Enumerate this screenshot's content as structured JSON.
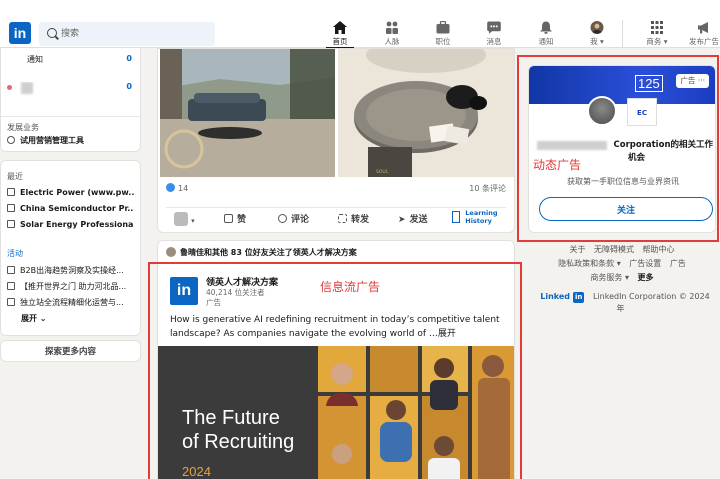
{
  "nav": {
    "search_placeholder": "搜索",
    "items": [
      {
        "label": "首页",
        "icon": "home-icon"
      },
      {
        "label": "人脉",
        "icon": "network-icon"
      },
      {
        "label": "职位",
        "icon": "briefcase-icon"
      },
      {
        "label": "消息",
        "icon": "message-icon"
      },
      {
        "label": "通知",
        "icon": "bell-icon"
      },
      {
        "label": "我 ▾",
        "icon": "avatar"
      },
      {
        "label": "商务 ▾",
        "icon": "grid-icon"
      },
      {
        "label": "发布广告",
        "icon": "megaphone-icon"
      }
    ]
  },
  "left": {
    "notifications": {
      "label": "通知",
      "count": "0"
    },
    "profile_count": "0",
    "business_title": "发展业务",
    "business_item": "试用营销管理工具",
    "recent_title": "最近",
    "recent": [
      "Electric Power (www.pw...",
      "China Semiconductor Pr...",
      "Solar Energy Professiona..."
    ],
    "events_title": "活动",
    "events": [
      "B2B出海趋势洞察及实操经...",
      "【推开世界之门 助力河北品...",
      "独立站全流程精细化运营与..."
    ],
    "expand": "展开 ⌄",
    "explore": "探索更多内容"
  },
  "post1": {
    "reactions": "14",
    "comments": "10 条评论",
    "actions": [
      "赞",
      "评论",
      "转发",
      "发送"
    ],
    "learning": [
      "Learning",
      "History"
    ]
  },
  "post2": {
    "followers_line": "鲁晴佳和其他 83 位好友关注了领英人才解决方案",
    "company": "领英人才解决方案",
    "followers": "40,214 位关注者",
    "tag": "广告",
    "text": "How is generative AI redefining recruitment in today’s competitive talent landscape? As companies navigate the evolving world of  …展开",
    "image_title_1": "The Future",
    "image_title_2": "of Recruiting",
    "image_year": "2024"
  },
  "right": {
    "ad_badge": "广告 ···",
    "banner_text": "125",
    "logo_text": "EC",
    "title_line1": "Corporation的相关工作",
    "title_line2": "机会",
    "subtitle": "获取第一手职位信息与业界资讯",
    "follow": "关注"
  },
  "footer": {
    "row1": [
      "关于",
      "无障碍模式",
      "帮助中心"
    ],
    "row2": [
      "隐私政策和条款 ▾",
      "广告设置",
      "广告"
    ],
    "row3": [
      "商务服务 ▾",
      "更多"
    ],
    "brand_word": "Linked",
    "brand_in": "in",
    "copyright": "LinkedIn Corporation © 2024 年"
  },
  "annotations": {
    "dynamic_ad": "动态广告",
    "feed_ad": "信息流广告",
    "color": "#e33a3a"
  },
  "colors": {
    "brand": "#0a66c2",
    "page_bg": "#f4f2ee",
    "ad_banner": "#1a3dbf"
  }
}
